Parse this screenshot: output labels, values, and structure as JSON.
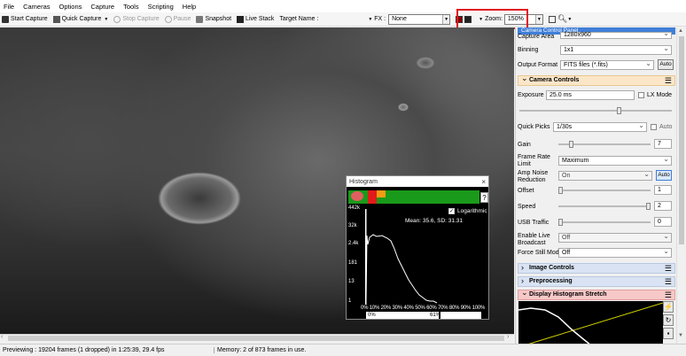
{
  "menu": [
    "File",
    "Cameras",
    "Options",
    "Capture",
    "Tools",
    "Scripting",
    "Help"
  ],
  "toolbar": {
    "start_capture": "Start Capture",
    "quick_capture": "Quick Capture",
    "stop_capture": "Stop Capture",
    "pause": "Pause",
    "snapshot": "Snapshot",
    "live_stack": "Live Stack",
    "target_name_label": "Target Name :",
    "fx_label": "FX :",
    "fx_value": "None",
    "zoom_label": "Zoom:",
    "zoom_value": "150%"
  },
  "histogram": {
    "title": "Histogram",
    "logarithmic_label": "Logarithmic",
    "logarithmic_checked": true,
    "stats": "Mean: 35.6, SD: 31.31",
    "y_labels": [
      "442k",
      "32k",
      "2.4k",
      "181",
      "13",
      "1"
    ],
    "x_labels": "0% 10% 20% 30% 40% 50% 60% 70% 80% 90% 100%",
    "range_low": "0%",
    "range_high": "61%"
  },
  "panel": {
    "title": "Camera Control Panel",
    "capture_area_label": "Capture Area",
    "capture_area_value": "1280x960",
    "binning_label": "Binning",
    "binning_value": "1x1",
    "output_format_label": "Output Format",
    "output_format_value": "FITS files (*.fits)",
    "auto_label": "Auto",
    "camera_controls": "Camera Controls",
    "exposure_label": "Exposure",
    "exposure_value": "25.0 ms",
    "lx_mode": "LX Mode",
    "quick_picks_label": "Quick Picks",
    "quick_picks_value": "1/30s",
    "auto_small": "Auto",
    "gain_label": "Gain",
    "gain_value": "7",
    "gain_level": 0.12,
    "frame_rate_label": "Frame Rate Limit",
    "frame_rate_value": "Maximum",
    "amp_noise_label": "Amp Noise Reduction",
    "amp_noise_value": "On",
    "offset_label": "Offset",
    "offset_value": "1",
    "offset_level": 0.0,
    "speed_label": "Speed",
    "speed_value": "2",
    "speed_level": 1.0,
    "usb_label": "USB Traffic",
    "usb_value": "0",
    "usb_level": 0.0,
    "live_broadcast_label": "Enable Live Broadcast",
    "live_broadcast_value": "Off",
    "force_still_label": "Force Still Mode",
    "force_still_value": "Off",
    "image_controls": "Image Controls",
    "preprocessing": "Preprocessing",
    "display_stretch": "Display Histogram Stretch"
  },
  "status": {
    "left": "Previewing : 19204 frames (1 dropped) in 1:25:39, 29.4 fps",
    "right": "Memory: 2 of 873 frames in use."
  },
  "colors": {
    "highlight_box": "#e0141e",
    "panel_title": "#3f7fd8",
    "histogram_bar": "#1a9a1a"
  }
}
